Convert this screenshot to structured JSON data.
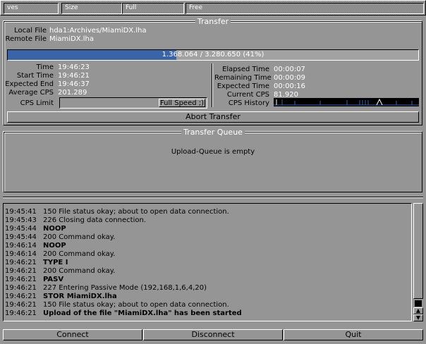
{
  "topbar": {
    "cells": [
      "ves",
      "Size",
      "Full",
      "Free"
    ]
  },
  "transfer": {
    "title": "Transfer",
    "local_file_label": "Local File",
    "local_file": "hda1:Archives/MiamiDX.lha",
    "remote_file_label": "Remote File",
    "remote_file": "MiamiDX.lha",
    "progress_text": "1.368.064 / 3.280.650 (41%)",
    "progress_fraction": 0.41,
    "stats_left": [
      {
        "label": "Time",
        "value": "19:46:23"
      },
      {
        "label": "Start Time",
        "value": "19:46:21"
      },
      {
        "label": "Expected End",
        "value": "19:46:37"
      },
      {
        "label": "Average CPS",
        "value": "201.289"
      }
    ],
    "stats_right": [
      {
        "label": "Elapsed Time",
        "value": "00:00:07"
      },
      {
        "label": "Remaining Time",
        "value": "00:00:09"
      },
      {
        "label": "Expected Time",
        "value": "00:00:16"
      },
      {
        "label": "Current CPS",
        "value": "81.920"
      },
      {
        "label": "CPS History",
        "value": ""
      }
    ],
    "cps_limit_label": "CPS Limit",
    "cps_limit_value": "Full Speed ;)",
    "abort_label": "Abort Transfer"
  },
  "queue": {
    "title": "Transfer Queue",
    "empty_text": "Upload-Queue is empty"
  },
  "log": [
    {
      "time": "19:45:41",
      "msg": "150 File status okay; about to open data connection.",
      "bold": false
    },
    {
      "time": "19:45:43",
      "msg": "226 Closing data connection.",
      "bold": false
    },
    {
      "time": "19:45:44",
      "msg": "NOOP",
      "bold": true
    },
    {
      "time": "19:45:44",
      "msg": "200 Command okay.",
      "bold": false
    },
    {
      "time": "19:46:14",
      "msg": "NOOP",
      "bold": true
    },
    {
      "time": "19:46:14",
      "msg": "200 Command okay.",
      "bold": false
    },
    {
      "time": "19:46:21",
      "msg": "TYPE I",
      "bold": true
    },
    {
      "time": "19:46:21",
      "msg": "200 Command okay.",
      "bold": false
    },
    {
      "time": "19:46:21",
      "msg": "PASV",
      "bold": true
    },
    {
      "time": "19:46:21",
      "msg": "227 Entering Passive Mode (192,168,1,6,4,20)",
      "bold": false
    },
    {
      "time": "19:46:21",
      "msg": "STOR MiamiDX.lha",
      "bold": true
    },
    {
      "time": "19:46:21",
      "msg": "150 File status okay; about to open data connection.",
      "bold": false
    },
    {
      "time": "19:46:21",
      "msg": "Upload of the file \"MiamiDX.lha\" has been started",
      "bold": true
    }
  ],
  "bottom_buttons": {
    "connect": "Connect",
    "disconnect": "Disconnect",
    "quit": "Quit"
  },
  "colors": {
    "background": "#959595",
    "progress": "#3a64a6",
    "highlight": "#ffffff"
  }
}
